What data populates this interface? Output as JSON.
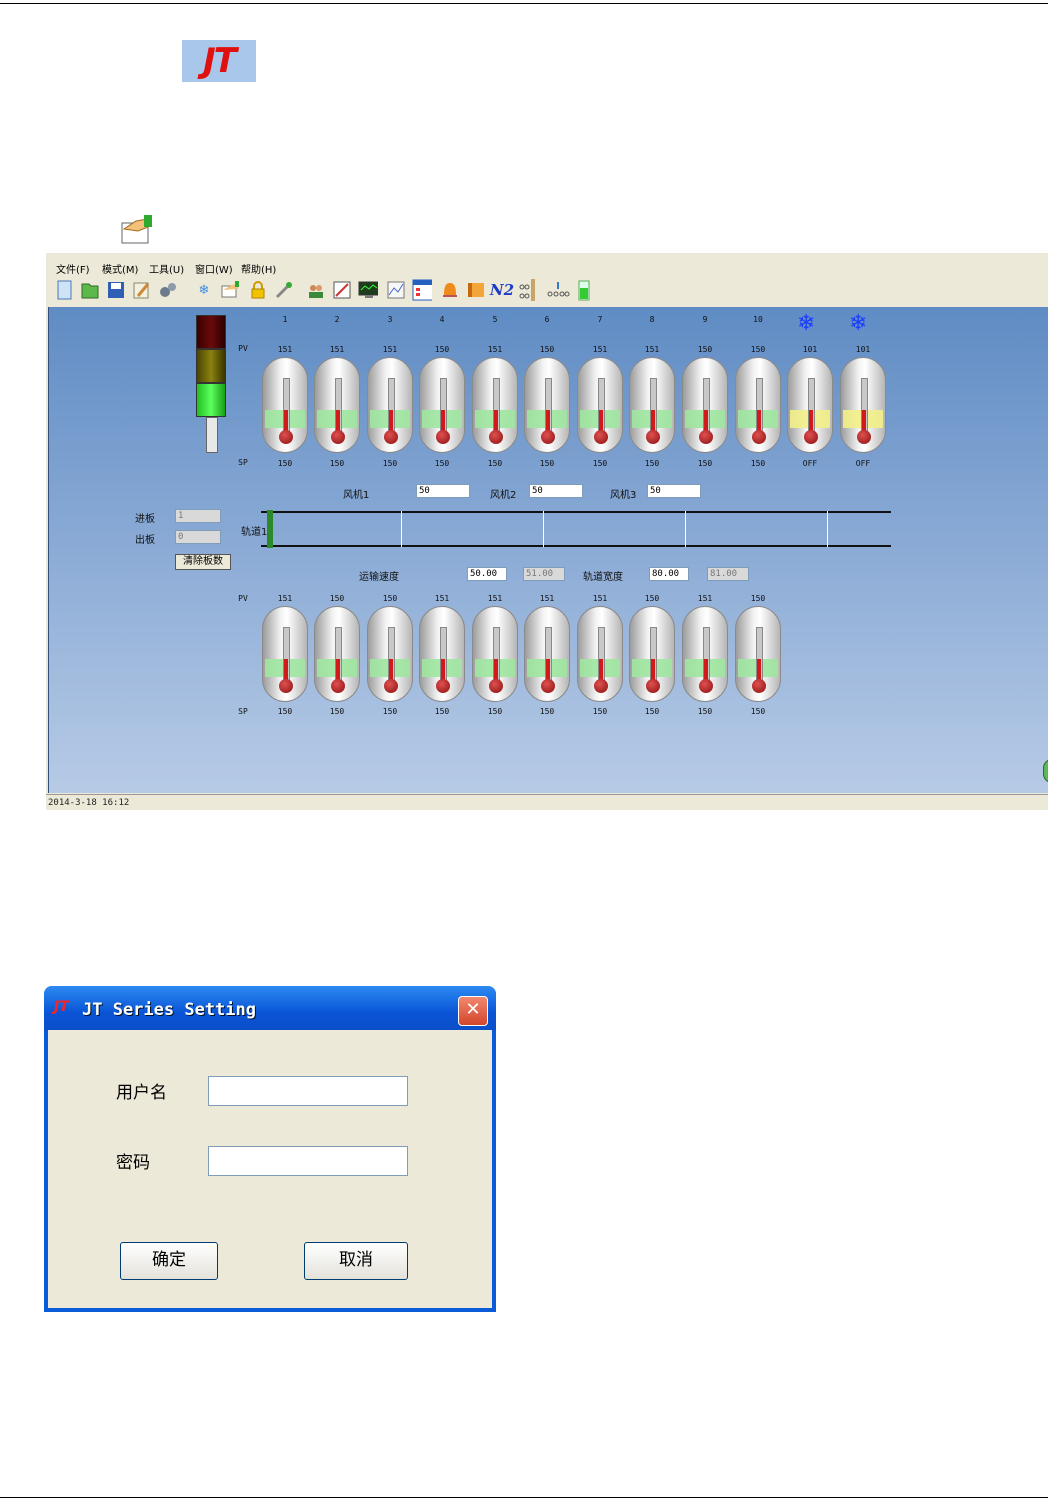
{
  "logo": {
    "text": "JT"
  },
  "menu": [
    {
      "label": "文件(F)"
    },
    {
      "label": "模式(M)"
    },
    {
      "label": "工具(U)"
    },
    {
      "label": "窗口(W)"
    },
    {
      "label": "帮助(H)"
    }
  ],
  "toolbar_icons": [
    "new-icon",
    "open-icon",
    "save-icon",
    "edit-icon",
    "gears-icon",
    "snowflake-icon",
    "hand-icon",
    "lock-icon",
    "tools-icon",
    "users-icon",
    "chart-icon",
    "monitor-icon",
    "graph-icon",
    "list-icon",
    "bell-icon",
    "heater-icon",
    "n2-icon",
    "rail-icon",
    "conveyor-icon",
    "battery-icon"
  ],
  "toolbar_n2": "N2",
  "zones_top": {
    "pv_label": "PV",
    "sp_label": "SP",
    "numbers": [
      "1",
      "2",
      "3",
      "4",
      "5",
      "6",
      "7",
      "8",
      "9",
      "10"
    ],
    "pv": [
      "151",
      "151",
      "151",
      "150",
      "151",
      "150",
      "151",
      "151",
      "150",
      "150",
      "101",
      "101"
    ],
    "sp": [
      "150",
      "150",
      "150",
      "150",
      "150",
      "150",
      "150",
      "150",
      "150",
      "150",
      "OFF",
      "OFF"
    ]
  },
  "fans": [
    {
      "label": "风机1",
      "value": "50"
    },
    {
      "label": "风机2",
      "value": "50"
    },
    {
      "label": "风机3",
      "value": "50"
    }
  ],
  "counters": {
    "in_label": "进板",
    "in_value": "1",
    "out_label": "出板",
    "out_value": "0",
    "clear_button": "清除板数"
  },
  "track": {
    "label": "轨道1"
  },
  "conveyor": {
    "speed_label": "运输速度",
    "speed_set": "50.00",
    "speed_actual": "51.00",
    "width_label": "轨道宽度",
    "width_set": "80.00",
    "width_actual": "81.00"
  },
  "zones_bottom": {
    "pv_label": "PV",
    "sp_label": "SP",
    "pv": [
      "151",
      "150",
      "150",
      "151",
      "151",
      "151",
      "151",
      "150",
      "151",
      "150"
    ],
    "sp": [
      "150",
      "150",
      "150",
      "150",
      "150",
      "150",
      "150",
      "150",
      "150",
      "150"
    ]
  },
  "status": {
    "datetime": "2014-3-18 16:12"
  },
  "dialog": {
    "title": "JT Series Setting",
    "title_logo": "JT",
    "close": "✕",
    "username_label": "用户名",
    "password_label": "密码",
    "ok": "确定",
    "cancel": "取消"
  },
  "colors": {
    "canvas_top": "#5f8cc4",
    "titlebar": "#0a55d6",
    "logo_red": "#e01010"
  }
}
